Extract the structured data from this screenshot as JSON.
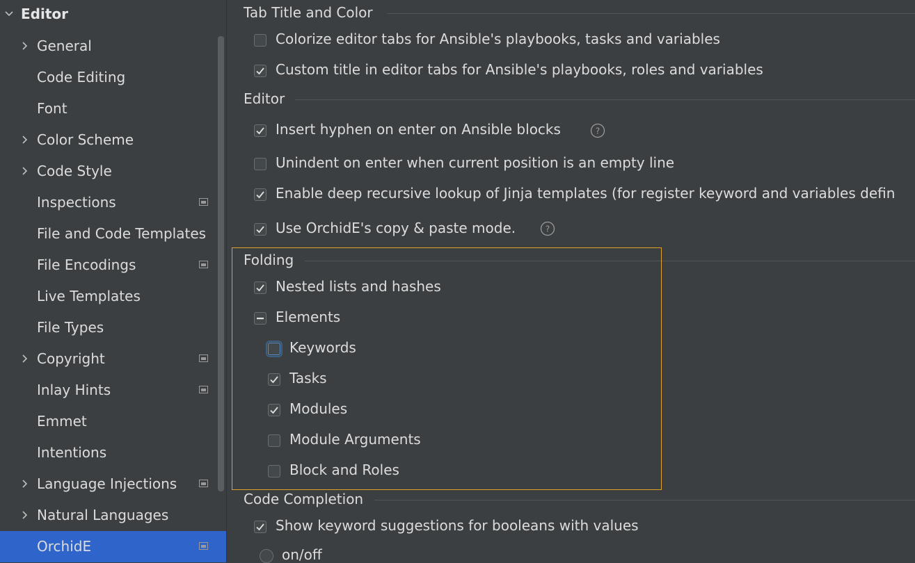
{
  "sidebar": {
    "header": "Editor",
    "items": [
      {
        "label": "General",
        "expandable": true,
        "badge": false
      },
      {
        "label": "Code Editing",
        "expandable": false,
        "badge": false
      },
      {
        "label": "Font",
        "expandable": false,
        "badge": false
      },
      {
        "label": "Color Scheme",
        "expandable": true,
        "badge": false
      },
      {
        "label": "Code Style",
        "expandable": true,
        "badge": false
      },
      {
        "label": "Inspections",
        "expandable": false,
        "badge": true
      },
      {
        "label": "File and Code Templates",
        "expandable": false,
        "badge": false
      },
      {
        "label": "File Encodings",
        "expandable": false,
        "badge": true
      },
      {
        "label": "Live Templates",
        "expandable": false,
        "badge": false
      },
      {
        "label": "File Types",
        "expandable": false,
        "badge": false
      },
      {
        "label": "Copyright",
        "expandable": true,
        "badge": true
      },
      {
        "label": "Inlay Hints",
        "expandable": false,
        "badge": true
      },
      {
        "label": "Emmet",
        "expandable": false,
        "badge": false
      },
      {
        "label": "Intentions",
        "expandable": false,
        "badge": false
      },
      {
        "label": "Language Injections",
        "expandable": true,
        "badge": true
      },
      {
        "label": "Natural Languages",
        "expandable": true,
        "badge": false
      },
      {
        "label": "OrchidE",
        "expandable": false,
        "badge": true,
        "selected": true
      }
    ]
  },
  "sections": {
    "tab_title": {
      "title": "Tab Title and Color",
      "colorize": {
        "label": "Colorize editor tabs for Ansible's playbooks, tasks and variables",
        "checked": false
      },
      "custom_title": {
        "label": "Custom title in editor tabs for Ansible's playbooks, roles and variables",
        "checked": true
      }
    },
    "editor": {
      "title": "Editor",
      "insert_hyphen": {
        "label": "Insert hyphen on enter on Ansible blocks",
        "checked": true
      },
      "unindent": {
        "label": "Unindent on enter when current position is an empty line",
        "checked": false
      },
      "deep_lookup": {
        "label": "Enable deep recursive lookup of Jinja templates (for register keyword and variables defin",
        "checked": true
      },
      "copy_paste": {
        "label": "Use OrchidE's copy & paste mode.",
        "checked": true
      }
    },
    "folding": {
      "title": "Folding",
      "nested": {
        "label": "Nested lists and hashes",
        "checked": true
      },
      "elements": {
        "label": "Elements",
        "state": "indeterminate"
      },
      "keywords": {
        "label": "Keywords",
        "checked": false
      },
      "tasks": {
        "label": "Tasks",
        "checked": true
      },
      "modules": {
        "label": "Modules",
        "checked": true
      },
      "module_args": {
        "label": "Module Arguments",
        "checked": false
      },
      "block_roles": {
        "label": "Block and Roles",
        "checked": false
      }
    },
    "completion": {
      "title": "Code Completion",
      "show_keyword": {
        "label": "Show keyword suggestions for booleans with values",
        "checked": true
      },
      "onoff": {
        "label": "on/off"
      }
    }
  },
  "colors": {
    "background": "#3c3f41",
    "selection": "#2f65ca",
    "highlight_border": "#e0a323",
    "text": "#dcdcdc"
  }
}
